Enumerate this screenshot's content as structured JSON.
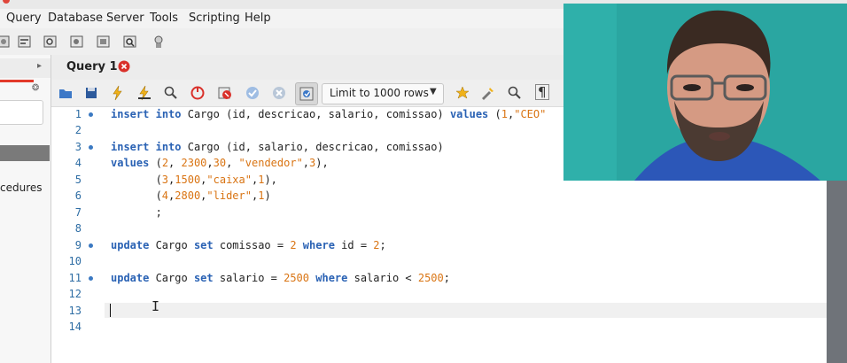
{
  "menu": {
    "items": [
      "Query",
      "Database",
      "Server",
      "Tools",
      "Scripting",
      "Help"
    ]
  },
  "sidebar": {
    "procedures_label": "cedures"
  },
  "tabs": [
    {
      "label": "Query 1"
    }
  ],
  "editor_toolbar": {
    "limit_label": "Limit to 1000 rows"
  },
  "editor": {
    "line_numbers": [
      "1",
      "2",
      "3",
      "4",
      "5",
      "6",
      "7",
      "8",
      "9",
      "10",
      "11",
      "12",
      "13",
      "14"
    ],
    "statement_markers_on_lines": [
      1,
      3,
      9,
      11
    ],
    "current_line": 13
  },
  "colors": {
    "keyword": "#2a62b4",
    "literal": "#d97413",
    "line_number": "#2e6da4",
    "tab_accent": "#e8762d",
    "webcam_bg": "#2aa6a1"
  },
  "icons": [
    "open-file-icon",
    "save-icon",
    "execute-icon",
    "execute-current-icon",
    "explain-icon",
    "stop-icon",
    "toggle-error-icon",
    "commit-icon",
    "rollback-icon",
    "autocommit-icon",
    "beautify-icon",
    "find-icon",
    "invisible-chars-icon",
    "close-tab-icon",
    "chevron-down-icon"
  ]
}
